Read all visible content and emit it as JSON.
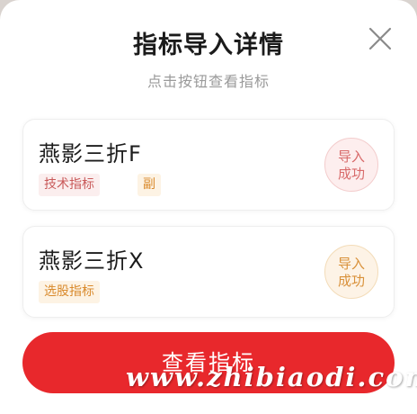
{
  "dialog": {
    "title": "指标导入详情",
    "subtitle": "点击按钮查看指标",
    "close_icon": "close-icon"
  },
  "items": [
    {
      "name": "燕影三折F",
      "tags": [
        "技术指标",
        "副"
      ],
      "status_line1": "导入",
      "status_line2": "成功"
    },
    {
      "name": "燕影三折X",
      "tags": [
        "选股指标"
      ],
      "status_line1": "导入",
      "status_line2": "成功"
    }
  ],
  "button": {
    "label": "查看指标"
  },
  "watermark": "www.zhibiaodi.com",
  "colors": {
    "primary": "#e8282c",
    "tag_red": "#c95a5a",
    "tag_orange": "#d98a2c"
  }
}
